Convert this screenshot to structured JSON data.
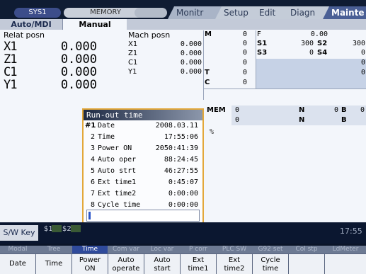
{
  "header": {
    "sys": "SYS1",
    "memory": "MEMORY",
    "menus": [
      "Monitr",
      "Setup",
      "Edit",
      "Diagn",
      "Mainte"
    ]
  },
  "mode_tabs": [
    "Auto/MDI",
    "Manual"
  ],
  "relat": {
    "title": "Relat posn",
    "axes": [
      {
        "name": "X1",
        "value": "0.000"
      },
      {
        "name": "Z1",
        "value": "0.000"
      },
      {
        "name": "C1",
        "value": "0.000"
      },
      {
        "name": "Y1",
        "value": "0.000"
      }
    ]
  },
  "mach": {
    "title": "Mach posn",
    "axes": [
      {
        "name": "X1",
        "value": "0.000"
      },
      {
        "name": "Z1",
        "value": "0.000"
      },
      {
        "name": "C1",
        "value": "0.000"
      },
      {
        "name": "Y1",
        "value": "0.000"
      }
    ]
  },
  "mst": {
    "rows": [
      {
        "a": "M",
        "b": "0",
        "c": "F",
        "d": "0.00",
        "e": "",
        "f": ""
      },
      {
        "a": "",
        "b": "0",
        "c": "S1",
        "d": "300",
        "e": "S2",
        "f": "300"
      },
      {
        "a": "",
        "b": "0",
        "c": "S3",
        "d": "0",
        "e": "S4",
        "f": "0"
      },
      {
        "a": "",
        "b": "0",
        "c": "",
        "d": "",
        "e": "",
        "f": "0"
      },
      {
        "a": "T",
        "b": "0",
        "c": "",
        "d": "",
        "e": "",
        "f": "0"
      },
      {
        "a": "C",
        "b": "0",
        "c": "",
        "d": "",
        "e": "",
        "f": ""
      }
    ]
  },
  "status": {
    "mem": "MEM",
    "row1": [
      "0",
      "N",
      "0",
      "B",
      "0"
    ],
    "row2": [
      "0",
      "N",
      "",
      "B",
      ""
    ],
    "percent": "%"
  },
  "runout": {
    "title": "Run-out time",
    "rows": [
      {
        "num": "#1",
        "label": "Date",
        "value": "2008.03.11"
      },
      {
        "num": "2",
        "label": "Time",
        "value": "17:55:06"
      },
      {
        "num": "3",
        "label": "Power ON",
        "value": "2050:41:39"
      },
      {
        "num": "4",
        "label": "Auto oper",
        "value": "88:24:45"
      },
      {
        "num": "5",
        "label": "Auto strt",
        "value": "46:27:55"
      },
      {
        "num": "6",
        "label": "Ext time1",
        "value": "0:45:07"
      },
      {
        "num": "7",
        "label": "Ext time2",
        "value": "0:00:00"
      },
      {
        "num": "8",
        "label": "Cycle time",
        "value": "0:00:00"
      }
    ]
  },
  "footer": {
    "sw_key": "S/W Key",
    "s1": "$1",
    "s2": "$2",
    "time": "17:55"
  },
  "menu_row": [
    "Modal",
    "Tree",
    "Time",
    "Com var",
    "Loc var",
    "P corr",
    "PLC SW",
    "G92 set",
    "Col stp",
    "LdMeter"
  ],
  "softkeys": [
    {
      "line1": "Date",
      "line2": ""
    },
    {
      "line1": "Time",
      "line2": ""
    },
    {
      "line1": "Power",
      "line2": "ON"
    },
    {
      "line1": "Auto",
      "line2": "operate"
    },
    {
      "line1": "Auto",
      "line2": "start"
    },
    {
      "line1": "Ext",
      "line2": "time1"
    },
    {
      "line1": "Ext",
      "line2": "time2"
    },
    {
      "line1": "Cycle",
      "line2": "time"
    },
    {
      "line1": "",
      "line2": ""
    },
    {
      "line1": "",
      "line2": ""
    }
  ],
  "colors": {
    "accent_orange": "#e3a83a",
    "header_dark": "#0f1c33",
    "highlight_blue": "#c6d2e6"
  }
}
